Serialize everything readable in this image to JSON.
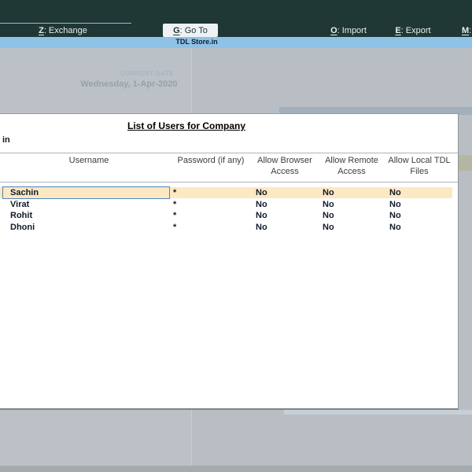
{
  "topbar": {
    "separator": ":",
    "items": [
      {
        "key": "Z",
        "label": "Exchange"
      },
      {
        "key": "G",
        "label": "Go To"
      },
      {
        "key": "O",
        "label": "Import"
      },
      {
        "key": "E",
        "label": "Export"
      },
      {
        "key": "M",
        "label": ""
      }
    ]
  },
  "banner": {
    "text": "TDL Store.in"
  },
  "background": {
    "current_date_label": "CURRENT DATE",
    "current_date_value": "Wednesday, 1-Apr-2020"
  },
  "dialog": {
    "title": "List of Users for Company",
    "company_name_fragment": "in",
    "columns": [
      "Username",
      "Password (if any)",
      "Allow Browser Access",
      "Allow Remote Access",
      "Allow Local TDL Files"
    ],
    "rows": [
      {
        "username": "Sachin",
        "password": "*",
        "allow_browser": "No",
        "allow_remote": "No",
        "allow_local_tdl": "No"
      },
      {
        "username": "Virat",
        "password": "*",
        "allow_browser": "No",
        "allow_remote": "No",
        "allow_local_tdl": "No"
      },
      {
        "username": "Rohit",
        "password": "*",
        "allow_browser": "No",
        "allow_remote": "No",
        "allow_local_tdl": "No"
      },
      {
        "username": "Dhoni",
        "password": "*",
        "allow_browser": "No",
        "allow_remote": "No",
        "allow_local_tdl": "No"
      }
    ]
  },
  "colors": {
    "topbar_bg": "#1f3735",
    "banner_bg": "#8fc2e7",
    "highlight_row": "#fce8c2",
    "selection_border": "#4d86c2",
    "dim_background": "#b8bec3"
  }
}
